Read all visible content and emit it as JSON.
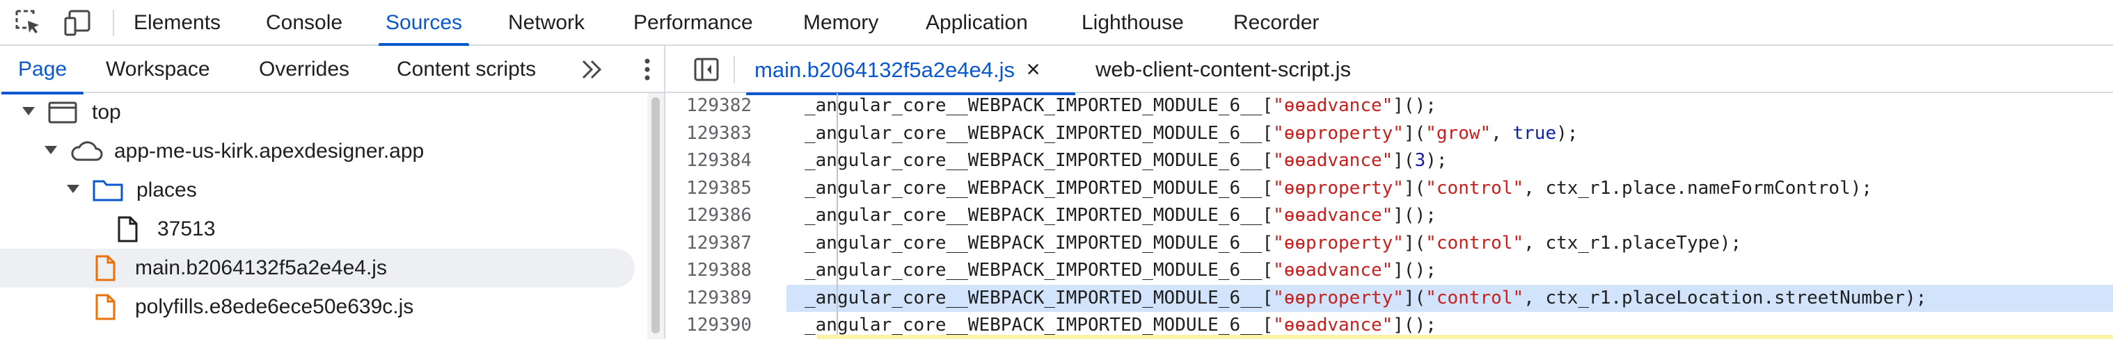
{
  "toolbar": {
    "icons": [
      "inspect-element-icon",
      "device-toolbar-icon"
    ],
    "tabs": [
      "Elements",
      "Console",
      "Sources",
      "Network",
      "Performance",
      "Memory",
      "Application",
      "Lighthouse",
      "Recorder"
    ],
    "active_tab": "Sources"
  },
  "navigator": {
    "tabs": [
      "Page",
      "Workspace",
      "Overrides",
      "Content scripts"
    ],
    "active_tab": "Page",
    "more_icon": "chevron-double-right-icon",
    "menu_icon": "kebab-menu-icon",
    "tree": [
      {
        "label": "top",
        "icon": "frame-icon",
        "expanded": true
      },
      {
        "label": "app-me-us-kirk.apexdesigner.app",
        "icon": "cloud-icon",
        "expanded": true
      },
      {
        "label": "places",
        "icon": "folder-icon",
        "expanded": true
      },
      {
        "label": "37513",
        "icon": "file-icon"
      },
      {
        "label": "main.b2064132f5a2e4e4.js",
        "icon": "js-file-icon",
        "selected": true
      },
      {
        "label": "polyfills.e8ede6ece50e639c.js",
        "icon": "js-file-icon"
      }
    ]
  },
  "editor": {
    "toggle_icon": "sidebar-toggle-icon",
    "tabs": [
      {
        "label": "main.b2064132f5a2e4e4.js",
        "active": true,
        "close": "×"
      },
      {
        "label": "web-client-content-script.js",
        "active": false
      }
    ],
    "highlighted_line": "129389",
    "lines": [
      {
        "num": "129382",
        "parts": [
          [
            "p",
            "_angular_core__WEBPACK_IMPORTED_MODULE_6__["
          ],
          [
            "s",
            "\"ɵɵadvance\""
          ],
          [
            "p",
            "]();"
          ]
        ]
      },
      {
        "num": "129383",
        "parts": [
          [
            "p",
            "_angular_core__WEBPACK_IMPORTED_MODULE_6__["
          ],
          [
            "s",
            "\"ɵɵproperty\""
          ],
          [
            "p",
            "]("
          ],
          [
            "s",
            "\"grow\""
          ],
          [
            "p",
            ", "
          ],
          [
            "k",
            "true"
          ],
          [
            "p",
            ");"
          ]
        ]
      },
      {
        "num": "129384",
        "parts": [
          [
            "p",
            "_angular_core__WEBPACK_IMPORTED_MODULE_6__["
          ],
          [
            "s",
            "\"ɵɵadvance\""
          ],
          [
            "p",
            "]("
          ],
          [
            "n",
            "3"
          ],
          [
            "p",
            ");"
          ]
        ]
      },
      {
        "num": "129385",
        "parts": [
          [
            "p",
            "_angular_core__WEBPACK_IMPORTED_MODULE_6__["
          ],
          [
            "s",
            "\"ɵɵproperty\""
          ],
          [
            "p",
            "]("
          ],
          [
            "s",
            "\"control\""
          ],
          [
            "p",
            ", ctx_r1.place.nameFormControl);"
          ]
        ]
      },
      {
        "num": "129386",
        "parts": [
          [
            "p",
            "_angular_core__WEBPACK_IMPORTED_MODULE_6__["
          ],
          [
            "s",
            "\"ɵɵadvance\""
          ],
          [
            "p",
            "]();"
          ]
        ]
      },
      {
        "num": "129387",
        "parts": [
          [
            "p",
            "_angular_core__WEBPACK_IMPORTED_MODULE_6__["
          ],
          [
            "s",
            "\"ɵɵproperty\""
          ],
          [
            "p",
            "]("
          ],
          [
            "s",
            "\"control\""
          ],
          [
            "p",
            ", ctx_r1.placeType);"
          ]
        ]
      },
      {
        "num": "129388",
        "parts": [
          [
            "p",
            "_angular_core__WEBPACK_IMPORTED_MODULE_6__["
          ],
          [
            "s",
            "\"ɵɵadvance\""
          ],
          [
            "p",
            "]();"
          ]
        ]
      },
      {
        "num": "129389",
        "parts": [
          [
            "p",
            "_angular_core__WEBPACK_IMPORTED_MODULE_6__["
          ],
          [
            "s",
            "\"ɵɵproperty\""
          ],
          [
            "p",
            "]("
          ],
          [
            "s",
            "\"control\""
          ],
          [
            "p",
            ", ctx_r1.placeLocation.streetNumber);"
          ]
        ]
      },
      {
        "num": "129390",
        "parts": [
          [
            "p",
            "_angular_core__WEBPACK_IMPORTED_MODULE_6__["
          ],
          [
            "s",
            "\"ɵɵadvance\""
          ],
          [
            "p",
            "]();"
          ]
        ]
      }
    ]
  },
  "colors": {
    "accent": "#0b57d0",
    "string": "#c5221f",
    "number": "#1a1aa6",
    "keyword": "#0d22aa",
    "selection": "#d2e3fc",
    "selected_row": "#eeeff2"
  }
}
